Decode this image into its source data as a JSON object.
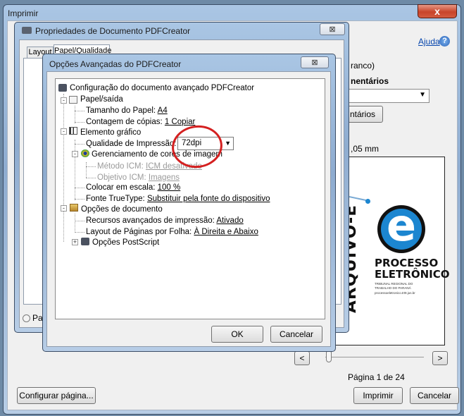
{
  "print_dialog": {
    "title": "Imprimir",
    "close_glyph": "x",
    "help_link": "Ajuda",
    "frag_branco": "ranco)",
    "frag_comentarios_heading": "nentários",
    "frag_comentarios_button": "ntários",
    "frag_size": ",05 mm",
    "orientation_frag": "Paisa",
    "page_indicator": "Página 1 de 24",
    "prev_glyph": "<",
    "next_glyph": ">",
    "setup_button": "Configurar página...",
    "print_button": "Imprimir",
    "cancel_button": "Cancelar"
  },
  "properties_dialog": {
    "title": "Propriedades de Documento PDFCreator",
    "close_glyph": "⊠",
    "tabs": [
      "Layout",
      "Papel/Qualidade"
    ]
  },
  "advanced_dialog": {
    "title": "Opções Avançadas do PDFCreator",
    "close_glyph": "⊠",
    "tree": {
      "root": "Configuração do documento avançado PDFCreator",
      "paper_output": "Papel/saída",
      "paper_size_label": "Tamanho do Papel:",
      "paper_size_value": "A4",
      "copies_label": "Contagem de cópias:",
      "copies_value": "1 Copiar",
      "graphic": "Elemento gráfico",
      "print_quality_label": "Qualidade de Impressão:",
      "print_quality_value": "72dpi",
      "color_mgmt": "Gerenciamento de cores de imagem",
      "icm_method_label": "Método ICM:",
      "icm_method_value": "ICM desativado",
      "icm_target_label": "Objetivo ICM:",
      "icm_target_value": "Imagens",
      "scale_label": "Colocar em escala:",
      "scale_value": "100 %",
      "truetype_label": "Fonte TrueType:",
      "truetype_value": "Substituir pela fonte do dispositivo",
      "doc_options": "Opções de documento",
      "advanced_features_label": "Recursos avançados de impressão:",
      "advanced_features_value": "Ativado",
      "pages_layout_label": "Layout de Páginas por Folha:",
      "pages_layout_value": "À Direita e Abaixo",
      "postscript": "Opções PostScript"
    },
    "ok_button": "OK",
    "cancel_button": "Cancelar"
  },
  "preview_logo": {
    "vertical_text": "ARQUIVO-E",
    "letter": "e",
    "line1": "PROCESSO",
    "line2": "ELETRÔNICO",
    "small1": "TRIBUNAL REGIONAL DO",
    "small2": "TRABALHO DO PARANÁ",
    "small3": "processoeletronico.trt9.jus.br"
  },
  "colors": {
    "annotation_circle": "#d42020",
    "logo_blue": "#1c86d0",
    "logo_black": "#111111"
  }
}
